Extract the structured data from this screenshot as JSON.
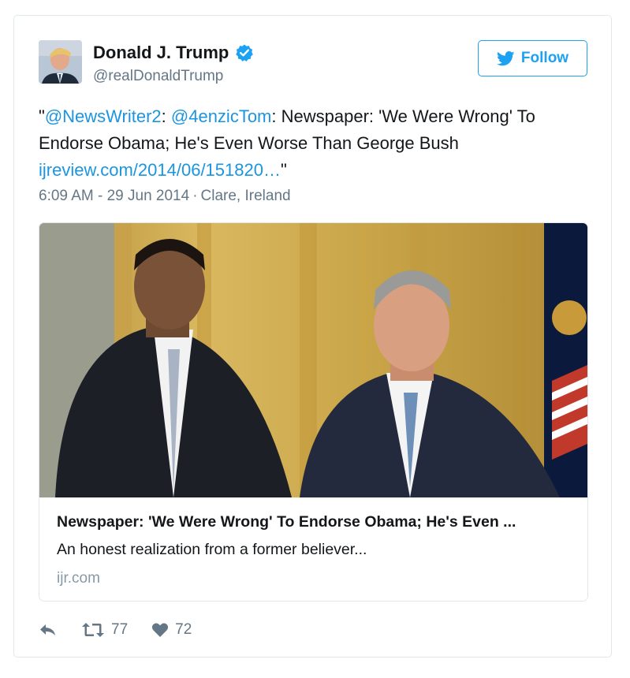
{
  "author": {
    "name": "Donald J. Trump",
    "handle": "@realDonaldTrump",
    "verified": true
  },
  "follow_button": {
    "label": "Follow",
    "icon": "twitter-bird-icon"
  },
  "tweet": {
    "open_quote": "\"",
    "mention1": "@NewsWriter2",
    "sep1": ": ",
    "mention2": "@4enzicTom",
    "body": ": Newspaper: 'We Were Wrong' To Endorse Obama; He's Even Worse Than George Bush ",
    "link": "ijreview.com/2014/06/151820…",
    "close_quote": "\""
  },
  "meta": {
    "timestamp": "6:09 AM - 29 Jun 2014",
    "separator": "·",
    "location": "Clare, Ireland"
  },
  "link_card": {
    "title": "Newspaper: 'We Were Wrong' To Endorse Obama; He's Even ...",
    "description": "An honest realization from a former believer...",
    "domain": "ijr.com"
  },
  "actions": {
    "retweet_count": "77",
    "like_count": "72"
  },
  "colors": {
    "accent": "#1da1f2",
    "link": "#1b95e0",
    "muted": "#657786",
    "border": "#e1e8ed"
  }
}
